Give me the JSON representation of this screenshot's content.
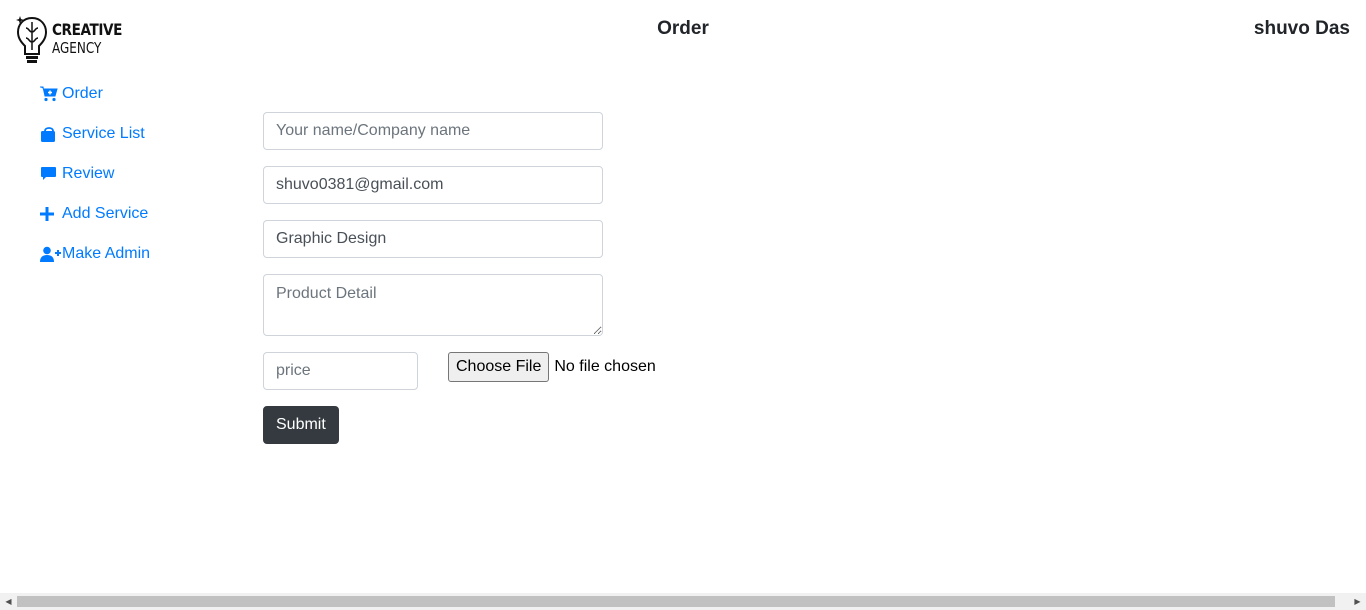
{
  "brand": {
    "line1": "CREATIVE",
    "line2": "AGENCY"
  },
  "header": {
    "title": "Order",
    "user_name": "shuvo Das"
  },
  "sidebar": {
    "items": [
      {
        "label": "Order",
        "icon": "cart-plus-icon"
      },
      {
        "label": "Service List",
        "icon": "shopping-bag-icon"
      },
      {
        "label": "Review",
        "icon": "comment-icon"
      },
      {
        "label": "Add Service",
        "icon": "plus-icon"
      },
      {
        "label": "Make Admin",
        "icon": "user-plus-icon"
      }
    ]
  },
  "form": {
    "name_placeholder": "Your name/Company name",
    "name_value": "",
    "email_value": "shuvo0381@gmail.com",
    "service_value": "Graphic Design",
    "detail_placeholder": "Product Detail",
    "price_placeholder": "price",
    "file_button": "Choose File",
    "file_status": "No file chosen",
    "submit_label": "Submit"
  },
  "colors": {
    "link": "#007bff",
    "submit_bg": "#343a40",
    "text": "#212529"
  }
}
